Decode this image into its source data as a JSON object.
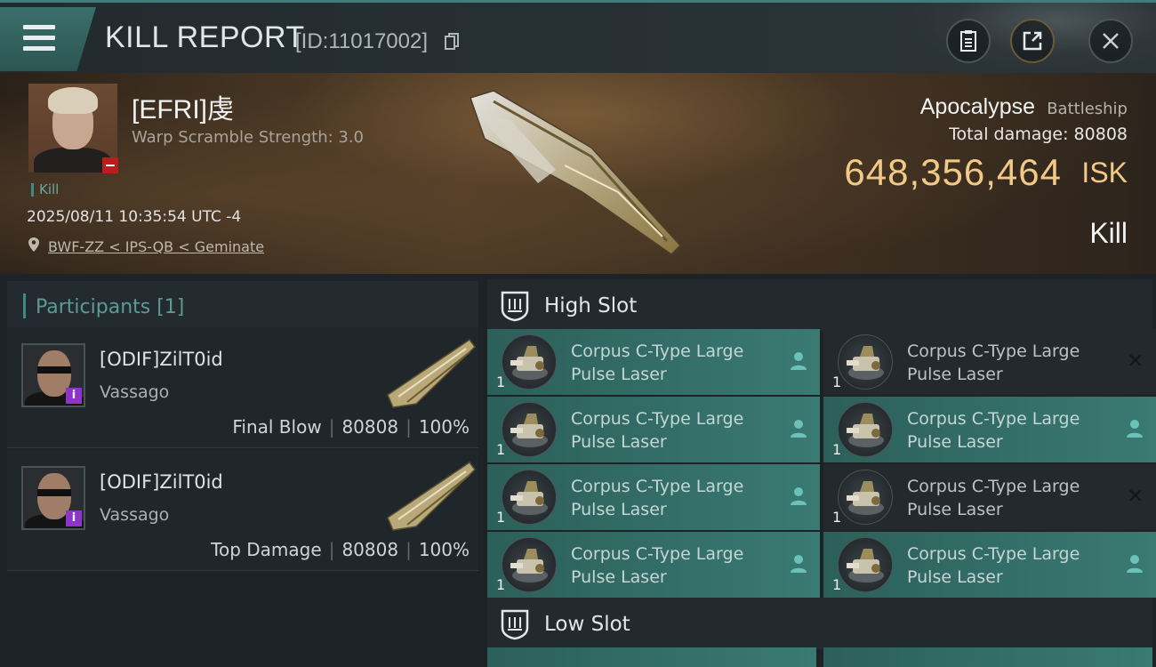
{
  "header": {
    "title": "KILL REPORT",
    "report_id": "[ID:11017002]"
  },
  "victim": {
    "name": "[EFRI]虔",
    "warp_scramble": "Warp Scramble Strength: 3.0",
    "tag": "Kill",
    "timestamp": "2025/08/11 10:35:54 UTC -4",
    "location": "BWF-ZZ < IPS-QB < Geminate",
    "ship_name": "Apocalypse",
    "ship_class": "Battleship",
    "total_damage": "Total damage:  80808",
    "isk_value": "648,356,464",
    "isk_unit": "ISK",
    "result": "Kill"
  },
  "participants": {
    "title": "Participants [1]",
    "rows": [
      {
        "name": "[ODIF]ZilT0id",
        "ship": "Vassago",
        "role": "Final Blow",
        "damage": "80808",
        "percent": "100%"
      },
      {
        "name": "[ODIF]ZilT0id",
        "ship": "Vassago",
        "role": "Top Damage",
        "damage": "80808",
        "percent": "100%"
      }
    ]
  },
  "slots": {
    "high_title": "High Slot",
    "low_title": "Low Slot",
    "modules": [
      {
        "name": "Corpus C-Type Large Pulse Laser",
        "qty": "1",
        "state": "active"
      },
      {
        "name": "Corpus C-Type Large Pulse Laser",
        "qty": "1",
        "state": "destroyed"
      },
      {
        "name": "Corpus C-Type Large Pulse Laser",
        "qty": "1",
        "state": "active"
      },
      {
        "name": "Corpus C-Type Large Pulse Laser",
        "qty": "1",
        "state": "active"
      },
      {
        "name": "Corpus C-Type Large Pulse Laser",
        "qty": "1",
        "state": "active"
      },
      {
        "name": "Corpus C-Type Large Pulse Laser",
        "qty": "1",
        "state": "destroyed"
      },
      {
        "name": "Corpus C-Type Large Pulse Laser",
        "qty": "1",
        "state": "active"
      },
      {
        "name": "Corpus C-Type Large Pulse Laser",
        "qty": "1",
        "state": "active"
      }
    ]
  },
  "icons": {
    "menu": "hamburger-menu-icon",
    "copy": "copy-icon",
    "clipboard": "clipboard-icon",
    "share": "share-icon",
    "close": "close-icon",
    "location": "map-pin-icon",
    "slot": "slot-shield-icon",
    "pilot": "person-icon"
  },
  "colors": {
    "accent": "#3e8b84",
    "isk": "#f2c987",
    "active_module": "#3a7a73",
    "loss_badge": "#b81e1e",
    "info_badge": "#8e34c9"
  }
}
